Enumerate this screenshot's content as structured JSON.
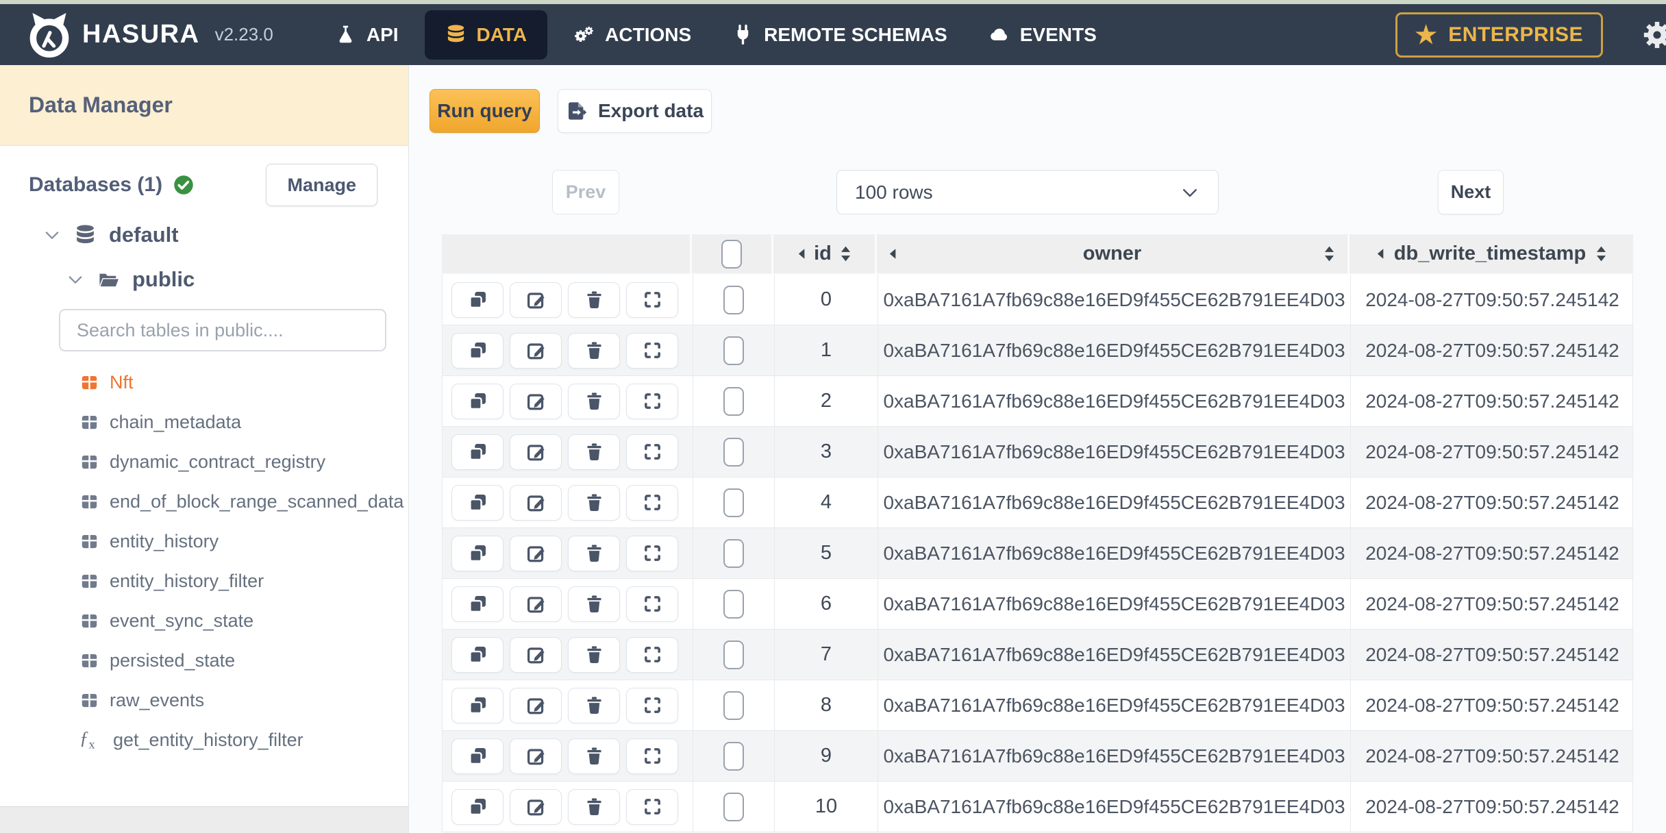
{
  "navbar": {
    "brand": "HASURA",
    "version": "v2.23.0",
    "tabs": [
      {
        "label": "API",
        "icon": "flask-icon",
        "active": false
      },
      {
        "label": "DATA",
        "icon": "database-icon",
        "active": true
      },
      {
        "label": "ACTIONS",
        "icon": "gears-icon",
        "active": false
      },
      {
        "label": "REMOTE SCHEMAS",
        "icon": "plug-icon",
        "active": false
      },
      {
        "label": "EVENTS",
        "icon": "cloud-icon",
        "active": false
      }
    ],
    "enterprise_label": "ENTERPRISE"
  },
  "sidebar": {
    "title": "Data Manager",
    "databases_label": "Databases (1)",
    "manage_label": "Manage",
    "tree": {
      "database": "default",
      "schema": "public"
    },
    "search_placeholder": "Search tables in public....",
    "tables": [
      {
        "name": "Nft",
        "type": "table",
        "active": true
      },
      {
        "name": "chain_metadata",
        "type": "table",
        "active": false
      },
      {
        "name": "dynamic_contract_registry",
        "type": "table",
        "active": false
      },
      {
        "name": "end_of_block_range_scanned_data",
        "type": "table",
        "active": false
      },
      {
        "name": "entity_history",
        "type": "table",
        "active": false
      },
      {
        "name": "entity_history_filter",
        "type": "table",
        "active": false
      },
      {
        "name": "event_sync_state",
        "type": "table",
        "active": false
      },
      {
        "name": "persisted_state",
        "type": "table",
        "active": false
      },
      {
        "name": "raw_events",
        "type": "table",
        "active": false
      },
      {
        "name": "get_entity_history_filter",
        "type": "function",
        "active": false
      }
    ]
  },
  "toolbar": {
    "run_query_label": "Run query",
    "export_data_label": "Export data"
  },
  "pagination": {
    "prev_label": "Prev",
    "rows_per_page": "100 rows",
    "next_label": "Next"
  },
  "table": {
    "columns": {
      "id": "id",
      "owner": "owner",
      "timestamp": "db_write_timestamp"
    },
    "rows": [
      {
        "id": "0",
        "owner": "0xaBA7161A7fb69c88e16ED9f455CE62B791EE4D03",
        "db_write_timestamp": "2024-08-27T09:50:57.245142"
      },
      {
        "id": "1",
        "owner": "0xaBA7161A7fb69c88e16ED9f455CE62B791EE4D03",
        "db_write_timestamp": "2024-08-27T09:50:57.245142"
      },
      {
        "id": "2",
        "owner": "0xaBA7161A7fb69c88e16ED9f455CE62B791EE4D03",
        "db_write_timestamp": "2024-08-27T09:50:57.245142"
      },
      {
        "id": "3",
        "owner": "0xaBA7161A7fb69c88e16ED9f455CE62B791EE4D03",
        "db_write_timestamp": "2024-08-27T09:50:57.245142"
      },
      {
        "id": "4",
        "owner": "0xaBA7161A7fb69c88e16ED9f455CE62B791EE4D03",
        "db_write_timestamp": "2024-08-27T09:50:57.245142"
      },
      {
        "id": "5",
        "owner": "0xaBA7161A7fb69c88e16ED9f455CE62B791EE4D03",
        "db_write_timestamp": "2024-08-27T09:50:57.245142"
      },
      {
        "id": "6",
        "owner": "0xaBA7161A7fb69c88e16ED9f455CE62B791EE4D03",
        "db_write_timestamp": "2024-08-27T09:50:57.245142"
      },
      {
        "id": "7",
        "owner": "0xaBA7161A7fb69c88e16ED9f455CE62B791EE4D03",
        "db_write_timestamp": "2024-08-27T09:50:57.245142"
      },
      {
        "id": "8",
        "owner": "0xaBA7161A7fb69c88e16ED9f455CE62B791EE4D03",
        "db_write_timestamp": "2024-08-27T09:50:57.245142"
      },
      {
        "id": "9",
        "owner": "0xaBA7161A7fb69c88e16ED9f455CE62B791EE4D03",
        "db_write_timestamp": "2024-08-27T09:50:57.245142"
      },
      {
        "id": "10",
        "owner": "0xaBA7161A7fb69c88e16ED9f455CE62B791EE4D03",
        "db_write_timestamp": "2024-08-27T09:50:57.245142"
      }
    ]
  },
  "colors": {
    "navbar_bg": "#323e4e",
    "nav_active_bg": "#141c2e",
    "accent_gold": "#efb54c",
    "active_table_orange": "#ee7532",
    "sidebar_header_cream": "#fcefd2",
    "success_green": "#3a9142",
    "run_query_amber": "#f0a62c"
  }
}
